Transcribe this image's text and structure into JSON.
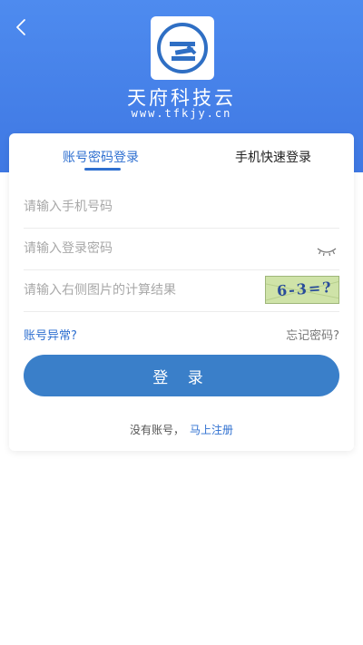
{
  "header": {
    "brand_name": "天府科技云",
    "brand_url": "www.tfkjy.cn",
    "accent": "#4e8bef"
  },
  "icons": {
    "back": "back-icon",
    "logo": "tfkjy-logo-icon",
    "eye": "eye-closed-icon"
  },
  "tabs": [
    {
      "label": "账号密码登录",
      "active": true
    },
    {
      "label": "手机快速登录",
      "active": false
    }
  ],
  "form": {
    "phone_placeholder": "请输入手机号码",
    "password_placeholder": "请输入登录密码",
    "captcha_placeholder": "请输入右侧图片的计算结果",
    "captcha_image_text": "6-3=?"
  },
  "links": {
    "account_issue": "账号异常?",
    "forgot_password": "忘记密码?"
  },
  "login_button": "登 录",
  "register": {
    "prompt": "没有账号，",
    "link": "马上注册"
  }
}
